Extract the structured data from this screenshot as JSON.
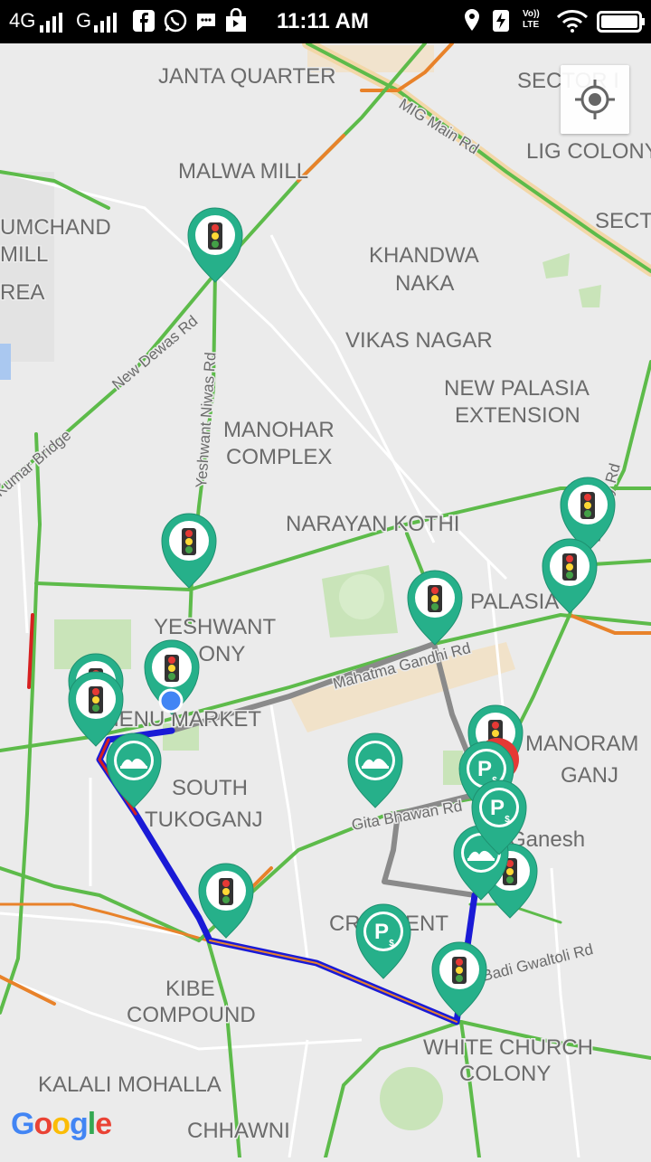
{
  "status_bar": {
    "network_1": "4G",
    "network_2": "G",
    "time": "11:11 AM",
    "volte": "Vo)) LTE"
  },
  "map": {
    "places": [
      "JANTA QUARTER",
      "SECTOR I",
      "LIG COLONY",
      "MALWA MILL",
      "SECTO",
      "UMCHAND",
      "MILL",
      "REA",
      "KHANDWA",
      "NAKA",
      "VIKAS NAGAR",
      "NEW PALASIA",
      "EXTENSION",
      "MANOHAR",
      "COMPLEX",
      "NARAYAN KOTHI",
      "PALASIA",
      "YESHWANT",
      "COLONY",
      "DHENU MARKET",
      "MANORAM",
      "GANJ",
      "SOUTH",
      "TUKOGANJ",
      "CRESCENT",
      "KIBE",
      "COMPOUND",
      "WHITE CHURCH",
      "COLONY",
      "KALALI MOHALLA",
      "CHHAWNI",
      "Ganesh"
    ],
    "roads": [
      "MIG Main Rd",
      "New Dewas Rd",
      "Yeshwant Niwas Rd",
      "Mahatma Gandhi Rd",
      "Gita Bhawan Rd",
      "Badi Gwaltoli Rd",
      "Kumar Bridge",
      "Bombay Rd"
    ]
  },
  "markers": {
    "traffic_icon": "traffic-light-icon",
    "parking_icon": "parking-icon",
    "speed_breaker_icon": "speed-breaker-icon",
    "parking_letter": "P",
    "parking_sub": "$"
  },
  "colors": {
    "marker_teal": "#26b08a",
    "route_blue": "#1a1ad6",
    "traffic_green": "#5dbb4a",
    "traffic_orange": "#e8822a",
    "traffic_red": "#d62020"
  },
  "attribution": "Google"
}
